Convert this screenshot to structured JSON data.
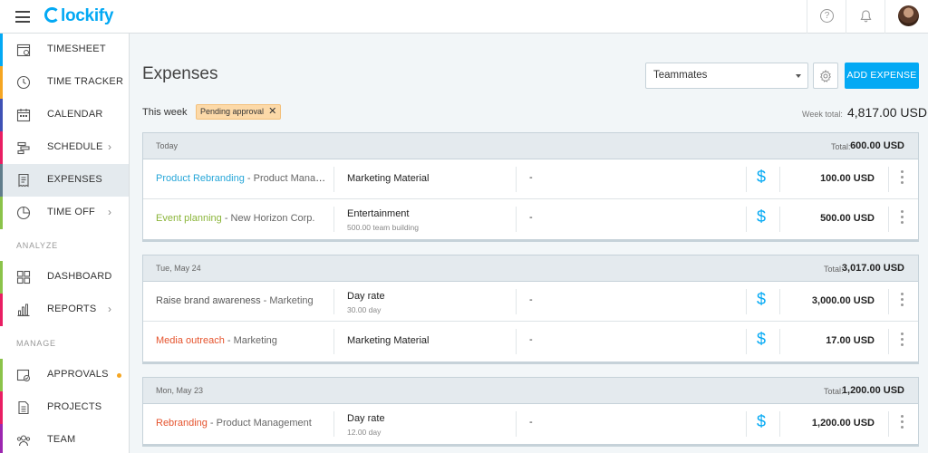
{
  "header": {
    "logo_text": "lockify",
    "help_glyph": "?"
  },
  "sidebar": {
    "items": [
      {
        "label": "TIMESHEET",
        "icon": "timesheet-icon",
        "color": "#03a9f4"
      },
      {
        "label": "TIME TRACKER",
        "icon": "clock-icon",
        "color": "#f5a623"
      },
      {
        "label": "CALENDAR",
        "icon": "calendar-icon",
        "color": "#3f51b5"
      },
      {
        "label": "SCHEDULE",
        "icon": "schedule-icon",
        "color": "#e91e63"
      },
      {
        "label": "EXPENSES",
        "icon": "receipt-icon",
        "color": "#607d8b",
        "active": true
      },
      {
        "label": "TIME OFF",
        "icon": "time-off-icon",
        "color": "#8bc34a"
      },
      {
        "label": "DASHBOARD",
        "icon": "dashboard-icon",
        "color": "#8bc34a"
      },
      {
        "label": "REPORTS",
        "icon": "reports-icon",
        "color": "#e91e63"
      },
      {
        "label": "APPROVALS",
        "icon": "approvals-icon",
        "color": "#8bc34a"
      },
      {
        "label": "PROJECTS",
        "icon": "projects-icon",
        "color": "#e91e63"
      },
      {
        "label": "TEAM",
        "icon": "team-icon",
        "color": "#9c27b0"
      }
    ],
    "section_analyze": "ANALYZE",
    "section_manage": "MANAGE",
    "chevron": "›"
  },
  "main": {
    "title": "Expenses",
    "teammates_label": "Teammates",
    "add_button": "ADD EXPENSE",
    "week_label": "This week",
    "filter_chip": "Pending approval",
    "filter_chip_close": "✕",
    "week_total_label": "Week total:",
    "week_total_value": "4,817.00 USD",
    "groups": [
      {
        "day": "Today",
        "total_label": "Total:",
        "total": "600.00 USD",
        "rows": [
          {
            "project": "Product Rebranding",
            "client": " - Product Managem…",
            "project_color": "#26a6d8",
            "category": "Marketing Material",
            "note": "",
            "desc": "-",
            "amount": "100.00 USD"
          },
          {
            "project": "Event planning",
            "client": " - New Horizon Corp.",
            "project_color": "#8bb53a",
            "category": "Entertainment",
            "note": "500.00 team building",
            "desc": "-",
            "amount": "500.00 USD"
          }
        ]
      },
      {
        "day": "Tue, May 24",
        "total_label": "Total:",
        "total": "3,017.00 USD",
        "rows": [
          {
            "project": "Raise brand awareness",
            "client": " - Marketing",
            "project_color": "#555555",
            "category": "Day rate",
            "note": "30.00 day",
            "desc": "-",
            "amount": "3,000.00 USD"
          },
          {
            "project": "Media outreach",
            "client": " - Marketing",
            "project_color": "#e5532d",
            "category": "Marketing Material",
            "note": "",
            "desc": "-",
            "amount": "17.00 USD"
          }
        ]
      },
      {
        "day": "Mon, May 23",
        "total_label": "Total:",
        "total": "1,200.00 USD",
        "rows": [
          {
            "project": "Rebranding",
            "client": " - Product Management",
            "project_color": "#e5532d",
            "category": "Day rate",
            "note": "12.00 day",
            "desc": "-",
            "amount": "1,200.00 USD"
          }
        ]
      }
    ],
    "dollar_glyph": "$"
  }
}
